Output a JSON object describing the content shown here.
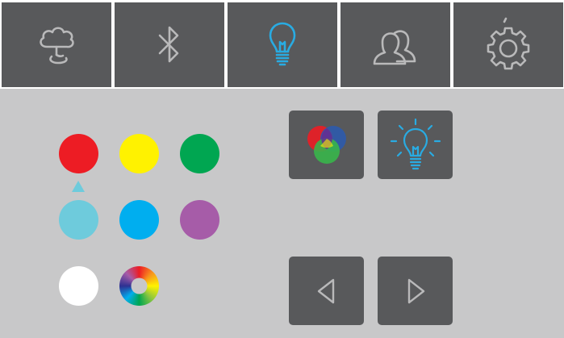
{
  "tabs": [
    {
      "name": "cloud",
      "icon": "cloud-tree-icon",
      "active": false
    },
    {
      "name": "bluetooth",
      "icon": "bluetooth-icon",
      "active": false
    },
    {
      "name": "light",
      "icon": "light-bulb-icon",
      "active": true
    },
    {
      "name": "profiles",
      "icon": "users-icon",
      "active": false
    },
    {
      "name": "settings",
      "icon": "gear-icon",
      "active": false
    }
  ],
  "colors": {
    "tab_bg": "#58595b",
    "icon_inactive": "#b9b9ba",
    "icon_active": "#29abe2",
    "panel_bg": "#c8c8c9",
    "selection_marker": "#6ecbdc"
  },
  "swatches": [
    {
      "name": "red",
      "color": "#ed1c24"
    },
    {
      "name": "yellow",
      "color": "#fff200"
    },
    {
      "name": "green",
      "color": "#00a651"
    },
    {
      "name": "light-cyan",
      "color": "#6ecbdc"
    },
    {
      "name": "blue",
      "color": "#00aeef"
    },
    {
      "name": "purple",
      "color": "#a65ca8"
    },
    {
      "name": "white",
      "color": "#ffffff"
    },
    {
      "name": "rainbow",
      "color": "multicolor"
    }
  ],
  "selected_swatch": "red",
  "mode_buttons": [
    {
      "name": "rgb-mode",
      "icon": "rgb-circles-icon"
    },
    {
      "name": "white-light-mode",
      "icon": "light-bulb-icon"
    }
  ],
  "nav_buttons": [
    {
      "name": "previous",
      "icon": "triangle-left-icon"
    },
    {
      "name": "next",
      "icon": "triangle-right-icon"
    }
  ]
}
